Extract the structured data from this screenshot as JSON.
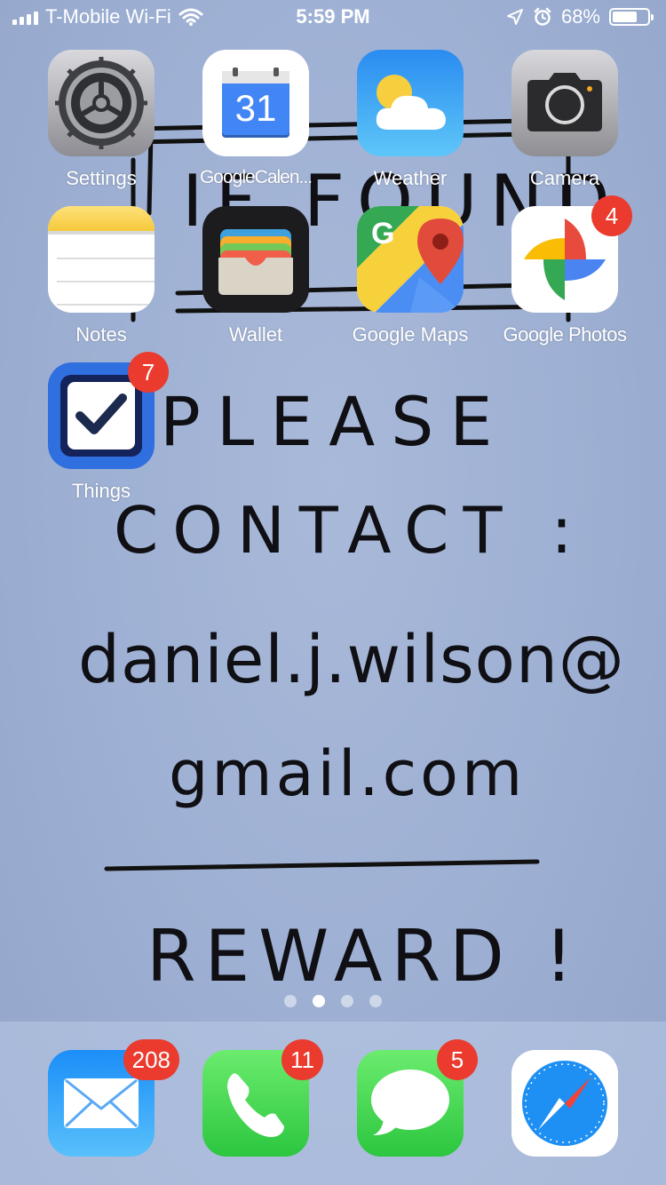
{
  "status_bar": {
    "carrier": "T-Mobile Wi-Fi",
    "time": "5:59 PM",
    "battery_percent": "68%",
    "battery_level": 0.68
  },
  "wallpaper": {
    "line1": "IF FOUND",
    "line2": "PLEASE",
    "line3": "CONTACT :",
    "line4": "daniel.j.wilson@",
    "line5": "gmail.com",
    "line6": "REWARD !"
  },
  "apps": {
    "settings": {
      "label": "Settings",
      "icon": "gear-icon"
    },
    "calendar": {
      "label": "GoogleCalen...",
      "day": "31",
      "icon": "calendar-icon"
    },
    "weather": {
      "label": "Weather",
      "icon": "weather-icon"
    },
    "camera": {
      "label": "Camera",
      "icon": "camera-icon"
    },
    "notes": {
      "label": "Notes",
      "icon": "notes-icon"
    },
    "wallet": {
      "label": "Wallet",
      "icon": "wallet-icon"
    },
    "maps": {
      "label": "Google Maps",
      "icon": "maps-icon"
    },
    "photos": {
      "label": "Google Photos",
      "badge": "4",
      "icon": "photos-pinwheel-icon"
    },
    "things": {
      "label": "Things",
      "badge": "7",
      "icon": "checkbox-icon"
    }
  },
  "page_indicator": {
    "count": 4,
    "active_index": 1
  },
  "dock": {
    "mail": {
      "badge": "208",
      "icon": "mail-icon"
    },
    "phone": {
      "badge": "11",
      "icon": "phone-icon"
    },
    "messages": {
      "badge": "5",
      "icon": "messages-icon"
    },
    "safari": {
      "icon": "compass-icon"
    }
  },
  "colors": {
    "badge": "#ea3b2e",
    "wallpaper": "#9fb1d4"
  }
}
